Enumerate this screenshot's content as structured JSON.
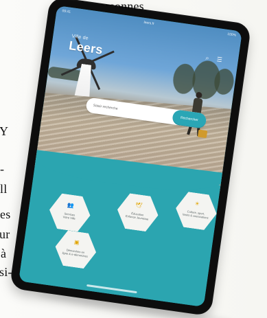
{
  "background_text": [
    "de personnes",
    "Y",
    "",
    "-",
    "ll",
    "es",
    "ur",
    "à",
    "si-"
  ],
  "statusbar": {
    "time": "09:41",
    "center": "leers.fr",
    "battery": "100%"
  },
  "header": {
    "subtitle": "Ville de",
    "title": "Leers",
    "icons": [
      "search-icon",
      "menu-icon"
    ]
  },
  "search": {
    "placeholder": "Saisir recherche",
    "button_label": "Rechercher"
  },
  "tiles": [
    {
      "label": "Services\nVotre Ville",
      "icon": "people-icon"
    },
    {
      "label": "Éducation\nEnfance Jeunesse",
      "icon": "bird-icon"
    },
    {
      "label": "Culture, sport,\nloisirs & associations",
      "icon": "sun-icon"
    },
    {
      "label": "Démarches en\nligne & e-démarches",
      "icon": "form-icon"
    }
  ]
}
